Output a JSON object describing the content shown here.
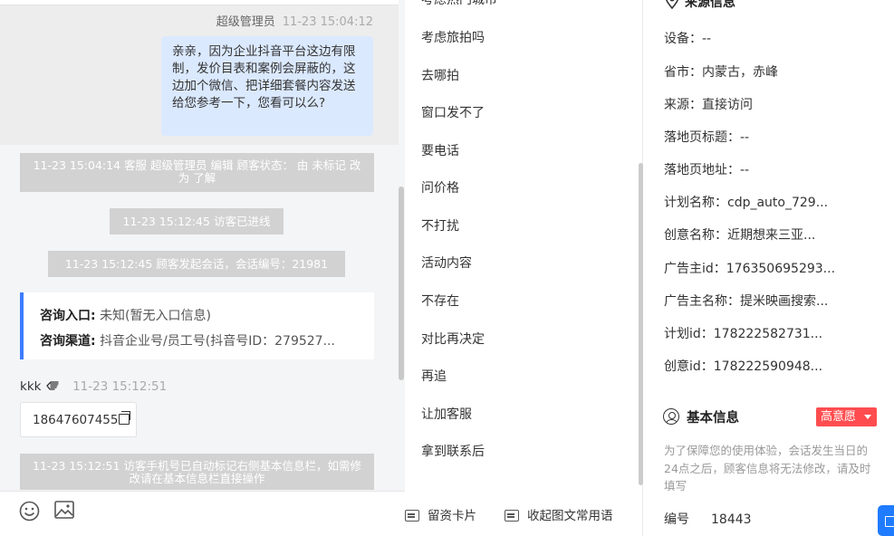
{
  "chat": {
    "agent_sender": "超级管理员",
    "agent_time": "11-23 15:04:12",
    "agent_message": "亲亲，因为企业抖音平台这边有限制，发价目表和案例会屏蔽的，这边加个微信、把详细套餐内容发送给您参考一下，您看可以么?",
    "system_messages": [
      "11-23 15:04:14 客服 超级管理员 编辑 顾客状态： 由 未标记 改为 了解",
      "11-23 15:12:45 访客已进线",
      "11-23 15:12:45 顾客发起会话，会话编号：21981",
      "11-23 15:12:51 访客手机号已自动标记右侧基本信息栏，如需修改请在基本信息栏直接操作"
    ],
    "consult_card": {
      "entry_label": "咨询入口:",
      "entry_value": "未知(暂无入口信息)",
      "channel_label": "咨询渠道:",
      "channel_value": "抖音企业号/员工号(抖音号ID：279527..."
    },
    "visitor_name": "kkk",
    "visitor_time": "11-23 15:12:51",
    "visitor_phone": "18647607455",
    "toolbar_icons": [
      "emoji-icon",
      "image-icon"
    ]
  },
  "quick_replies": {
    "items": [
      "考虑热门城市",
      "考虑旅拍吗",
      "去哪拍",
      "窗口发不了",
      "要电话",
      "问价格",
      "不打扰",
      "活动内容",
      "不存在",
      "对比再决定",
      "再追",
      "让加客服",
      "拿到联系后"
    ],
    "buttons": [
      "留资卡片",
      "收起图文常用语"
    ]
  },
  "info": {
    "source_title": "来源信息",
    "rows": [
      "设备：--",
      "省市：内蒙古，赤峰",
      "来源：直接访问",
      "落地页标题：--",
      "落地页地址：--",
      "计划名称：cdp_auto_729...",
      "创意名称：近期想来三亚...",
      "广告主id：176350695293...",
      "广告主名称：提米映画搜索...",
      "计划id：178222582731...",
      "创意id：178222590948..."
    ],
    "basic_title": "基本信息",
    "intent_label": "高意愿",
    "notice": "为了保障您的使用体验，会话发生当日的24点之后，顾客信息将无法修改，请及时填写",
    "code_label": "编号",
    "code_value": "18443"
  },
  "colors": {
    "accent": "#3d7dff",
    "bubble": "#dbe9ff",
    "system_bg": "#d2d2d2",
    "badge_red": "#ff4d4f"
  }
}
